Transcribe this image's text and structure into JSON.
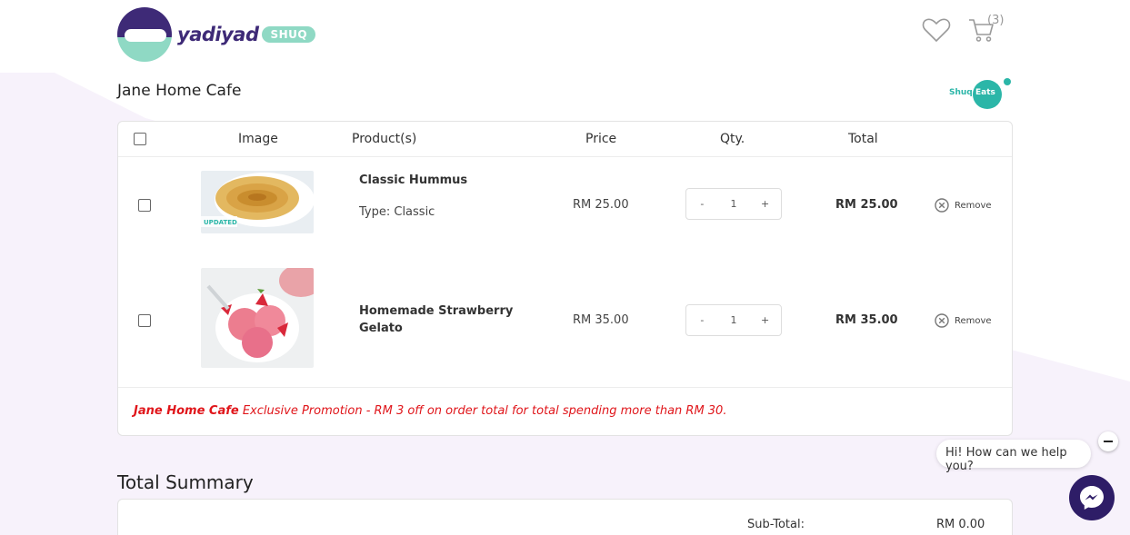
{
  "header": {
    "logo_text": "yadiyad",
    "logo_badge": "SHUQ",
    "cart_count": "(3)",
    "icons": [
      "heart-icon",
      "cart-icon"
    ]
  },
  "store": {
    "name": "Jane Home Cafe",
    "shuq_eats_part1": "Shuq",
    "shuq_eats_part2": "Eats"
  },
  "cart": {
    "columns": {
      "image": "Image",
      "products": "Product(s)",
      "price": "Price",
      "qty": "Qty.",
      "total": "Total"
    },
    "items": [
      {
        "name": "Classic Hummus",
        "type": "Type: Classic",
        "price": "RM 25.00",
        "qty_minus": "-",
        "qty": "1",
        "qty_plus": "+",
        "total": "RM 25.00",
        "remove": "Remove",
        "image_tag": "UPDATED"
      },
      {
        "name": "Homemade Strawberry Gelato",
        "type": "",
        "price": "RM 35.00",
        "qty_minus": "-",
        "qty": "1",
        "qty_plus": "+",
        "total": "RM 35.00",
        "remove": "Remove",
        "image_tag": ""
      }
    ],
    "promo_store": "Jane Home Cafe",
    "promo_text": " Exclusive Promotion - RM 3 off on order total for total spending more than RM 30."
  },
  "summary": {
    "title": "Total Summary",
    "subtotal_label": "Sub-Total:",
    "subtotal_value": "RM 0.00"
  },
  "chat": {
    "greeting": "Hi! How can we help you?"
  },
  "colors": {
    "brand_purple": "#3e2a77",
    "brand_mint": "#8fd9c4",
    "teal": "#2bb6a8",
    "promo_red": "#e0161b",
    "messenger_bg": "#2e1d67"
  }
}
